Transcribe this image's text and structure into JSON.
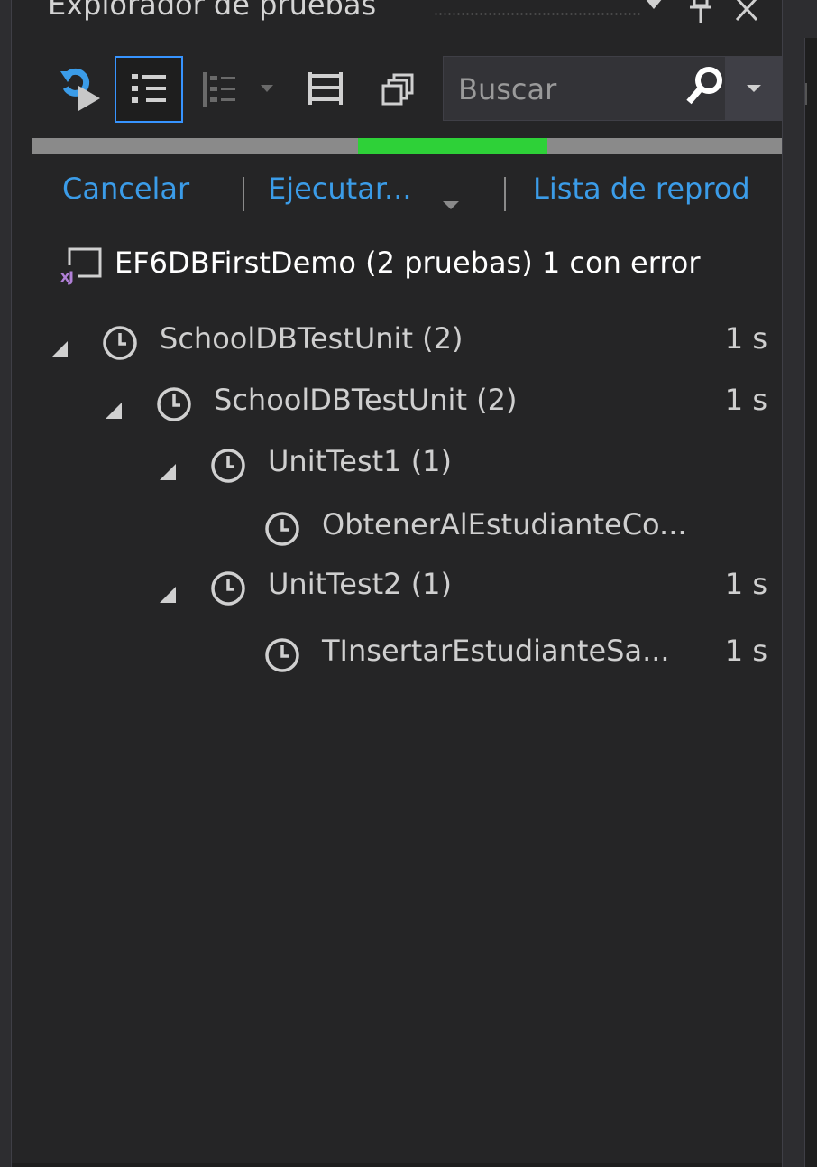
{
  "window": {
    "title": "Explorador de pruebas",
    "accent": "#3794ff",
    "background": "#252526"
  },
  "titlebar_buttons": [
    {
      "icon": "dropdown-arrow-icon"
    },
    {
      "icon": "pin-icon"
    },
    {
      "icon": "close-icon"
    }
  ],
  "toolbar": {
    "tools": [
      {
        "name": "run-all-icon",
        "selected": false
      },
      {
        "name": "group-by-hierarchy-icon",
        "selected": true
      },
      {
        "name": "group-by-icon",
        "selected": false
      },
      {
        "name": "columns-icon",
        "selected": false
      },
      {
        "name": "copy-icon",
        "selected": false
      }
    ],
    "search": {
      "placeholder": "Buscar",
      "icon": "search-icon"
    }
  },
  "progress": {
    "track_color": "#8a8a8a",
    "fill_color": "#2ed138"
  },
  "commands": {
    "cancel": "Cancelar",
    "run": "Ejecutar...",
    "playlist": "Lista de reprod",
    "link_color": "#3b9ce8"
  },
  "summary": {
    "text": "EF6DBFirstDemo (2 pruebas) 1 con error",
    "icon": "test-project-icon"
  },
  "tree": [
    {
      "label": "SchoolDBTestUnit (2)",
      "duration": "1 s",
      "level": 0,
      "expanded": true
    },
    {
      "label": "SchoolDBTestUnit (2)",
      "duration": "1 s",
      "level": 1,
      "expanded": true
    },
    {
      "label": "UnitTest1 (1)",
      "duration": "",
      "level": 2,
      "expanded": true
    },
    {
      "label": "ObtenerAlEstudianteCo...",
      "duration": "",
      "level": 3,
      "expanded": null
    },
    {
      "label": "UnitTest2 (1)",
      "duration": "1 s",
      "level": 2,
      "expanded": true
    },
    {
      "label": "TInsertarEstudianteSa...",
      "duration": "1 s",
      "level": 3,
      "expanded": null
    }
  ]
}
